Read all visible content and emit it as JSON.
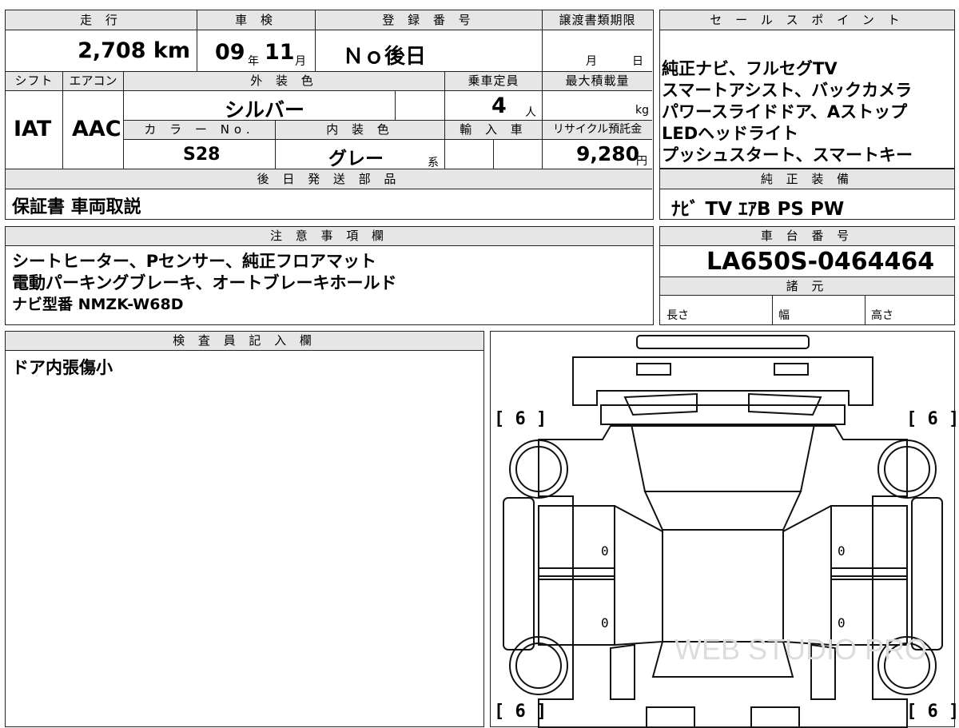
{
  "top_table": {
    "headers": {
      "mileage": "走 行",
      "inspection": "車 検",
      "registration": "登 録 番 号",
      "transfer_deadline": "譲渡書類期限",
      "shift": "シフト",
      "aircon": "エアコン",
      "exterior_color": "外 装 色",
      "capacity": "乗車定員",
      "max_load": "最大積載量",
      "color_no": "カ ラ ー No.",
      "interior_color": "内 装 色",
      "import": "輸 入 車",
      "recycle_fee": "リサイクル預託金",
      "later_parts": "後 日 発 送 部 品"
    },
    "values": {
      "mileage": "2,708 km",
      "inspection_year": "09",
      "inspection_year_unit": "年",
      "inspection_month": "11",
      "inspection_month_unit": "月",
      "registration": "Ｎｏ後日",
      "transfer_month_unit": "月",
      "transfer_day_unit": "日",
      "shift": "IAT",
      "aircon": "AAC",
      "exterior_color": "シルバー",
      "capacity": "4",
      "capacity_unit": "人",
      "max_load_unit": "kg",
      "color_no": "S28",
      "interior_color": "グレー",
      "interior_color_suffix": "系",
      "recycle_fee": "9,280",
      "recycle_fee_unit": "円",
      "later_parts": "保証書 車両取説"
    }
  },
  "sales_points": {
    "header": "セ ー ル ス ポ イ ン ト",
    "lines": [
      "純正ナビ、フルセグTV",
      "スマートアシスト、バックカメラ",
      "パワースライドドア、Aストップ",
      "LEDヘッドライト",
      "プッシュスタート、スマートキー"
    ]
  },
  "standard_equipment": {
    "header": "純 正 装 備",
    "value": "ﾅﾋﾞ TV ｴｱB PS PW"
  },
  "notes": {
    "header": "注 意 事 項 欄",
    "lines": [
      "シートヒーター、Pセンサー、純正フロアマット",
      "電動パーキングブレーキ、オートブレーキホールド",
      "ナビ型番 NMZK-W68D"
    ]
  },
  "chassis": {
    "header": "車 台 番 号",
    "value": "LA650S-0464464"
  },
  "specs": {
    "header": "諸 元",
    "length": "長さ",
    "width": "幅",
    "height": "高さ"
  },
  "inspector": {
    "header": "検 査 員 記 入 欄",
    "note": "ドア内張傷小"
  },
  "diagram": {
    "tire_front_left": "[ 6 ]",
    "tire_front_right": "[ 6 ]",
    "tire_rear_left": "[ 6 ]",
    "tire_rear_right": "[ 6 ]",
    "door_marks": [
      "0",
      "0",
      "0",
      "0"
    ],
    "watermark": "WEB STUDIO PRO"
  }
}
